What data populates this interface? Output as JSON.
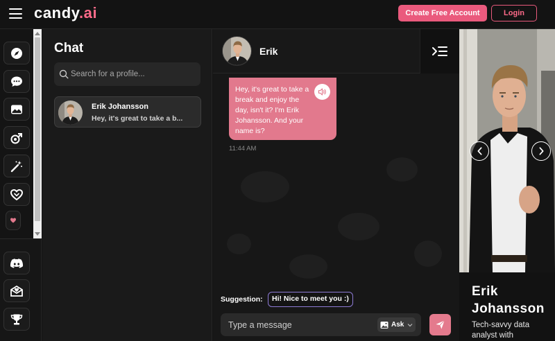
{
  "header": {
    "logo_main": "candy",
    "logo_accent": ".ai",
    "create_account_label": "Create Free Account",
    "login_label": "Login"
  },
  "rail": {
    "top_icons": [
      "compass-icon",
      "chat-bubble-icon",
      "gallery-icon",
      "generate-icon",
      "magic-wand-icon",
      "heart-hands-icon",
      "small-heart-icon"
    ],
    "bottom_icons": [
      "discord-icon",
      "love-letter-icon",
      "trophy-icon"
    ]
  },
  "chat_list": {
    "title": "Chat",
    "search_placeholder": "Search for a profile...",
    "contacts": [
      {
        "name": "Erik Johansson",
        "preview": "Hey, it's great to take a b..."
      }
    ]
  },
  "chat": {
    "header_name": "Erik",
    "messages": [
      {
        "text": "Hey, it's great to take a break and enjoy the day, isn't it? I'm Erik Johansson. And your name is?",
        "time": "11:44 AM"
      }
    ],
    "suggestion_label": "Suggestion:",
    "suggestion_text": "Hi! Nice to meet you :)",
    "composer_placeholder": "Type a message",
    "ask_label": "Ask"
  },
  "profile": {
    "name": "Erik Johansson",
    "bio": "Tech-savvy data analyst with"
  },
  "colors": {
    "accent": "#ea5a7d",
    "bubble": "#e2798d",
    "suggestion_border": "#8e7bd6",
    "background": "#131313"
  }
}
